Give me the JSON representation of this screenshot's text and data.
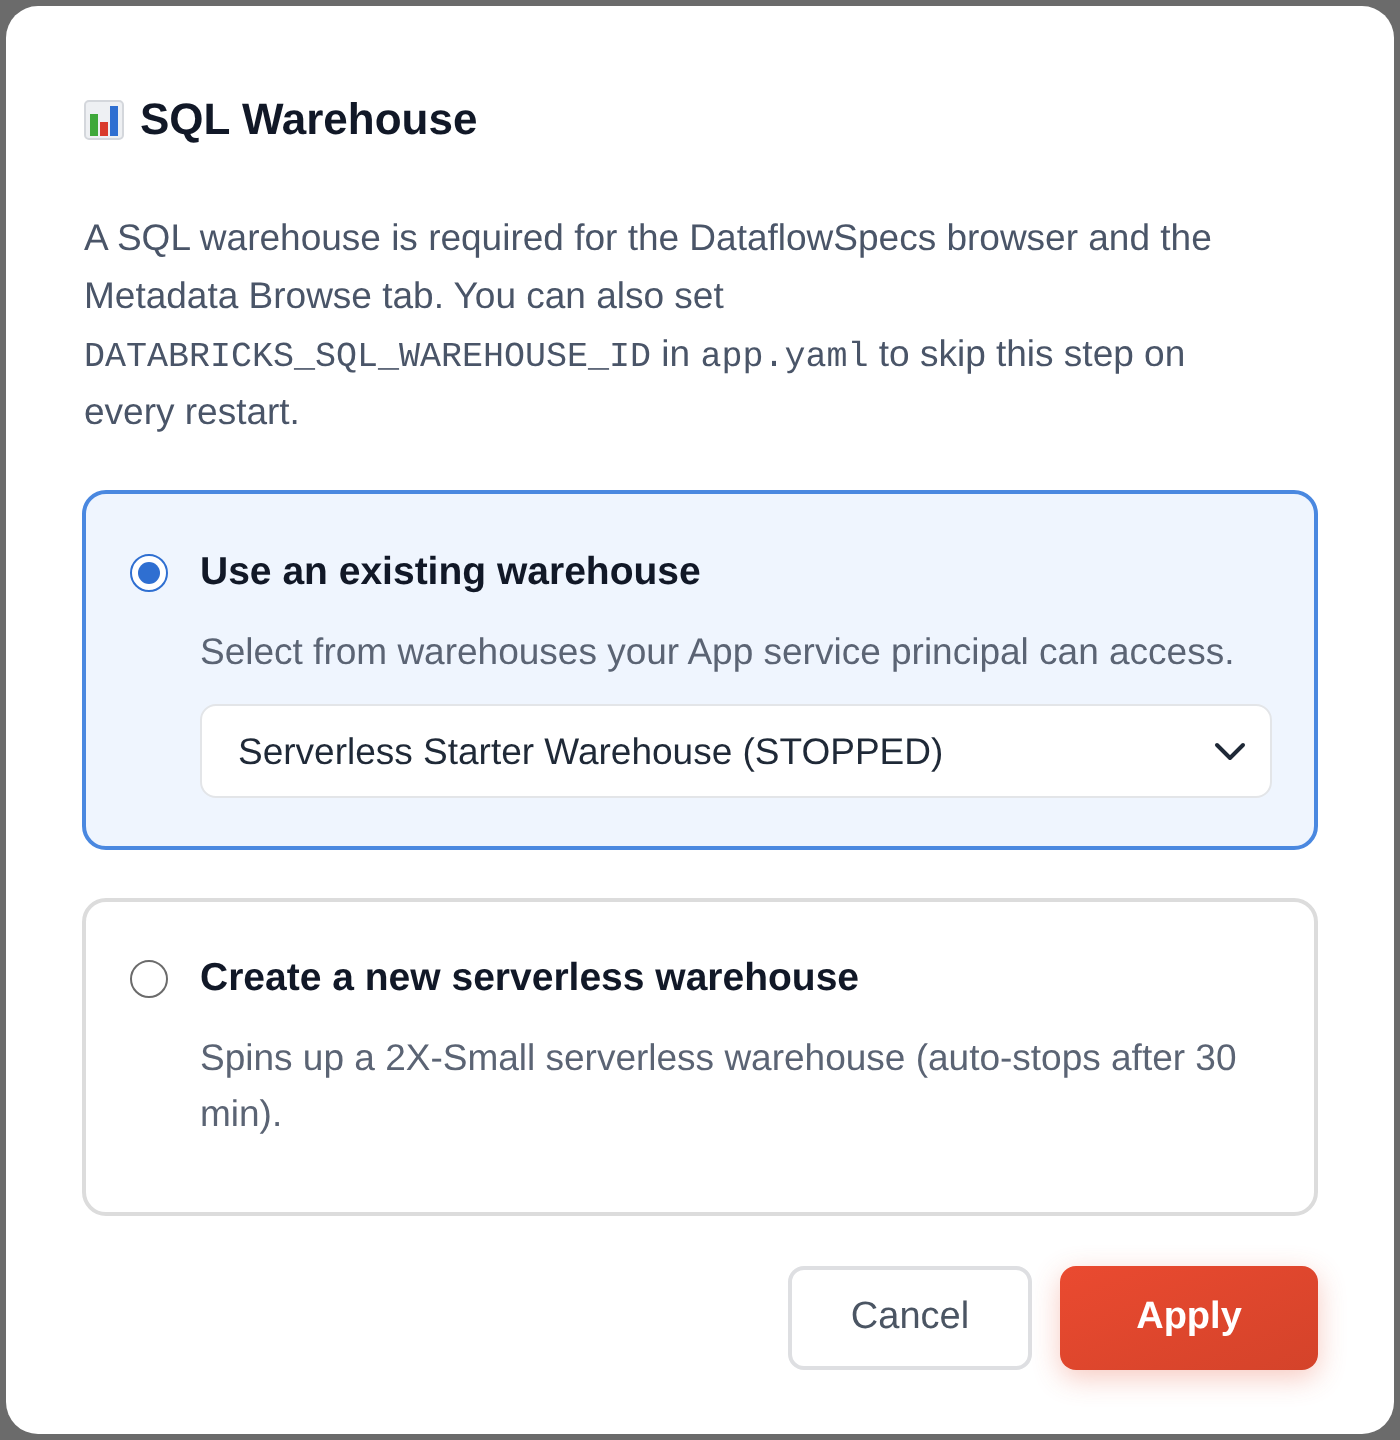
{
  "dialog": {
    "title": "SQL Warehouse",
    "description": [
      {
        "kind": "text",
        "text": "A SQL warehouse is required for the DataflowSpecs browser and the Metadata Browse tab. You can also set "
      },
      {
        "kind": "code",
        "text": "DATABRICKS_SQL_WAREHOUSE_ID"
      },
      {
        "kind": "text",
        "text": " in "
      },
      {
        "kind": "code",
        "text": "app.yaml"
      },
      {
        "kind": "text",
        "text": " to skip this step on every restart."
      }
    ]
  },
  "options": [
    {
      "label": "Use an existing warehouse",
      "selected": true,
      "hint": "Select from warehouses your App service principal can access.",
      "select": {
        "value": "Serverless Starter Warehouse (STOPPED)"
      }
    },
    {
      "label": "Create a new serverless warehouse",
      "selected": false,
      "hint": "Spins up a 2X-Small serverless warehouse (auto-stops after 30 min)."
    }
  ],
  "buttons": [
    {
      "label": "Cancel",
      "kind": "secondary"
    },
    {
      "label": "Apply",
      "kind": "primary"
    }
  ]
}
